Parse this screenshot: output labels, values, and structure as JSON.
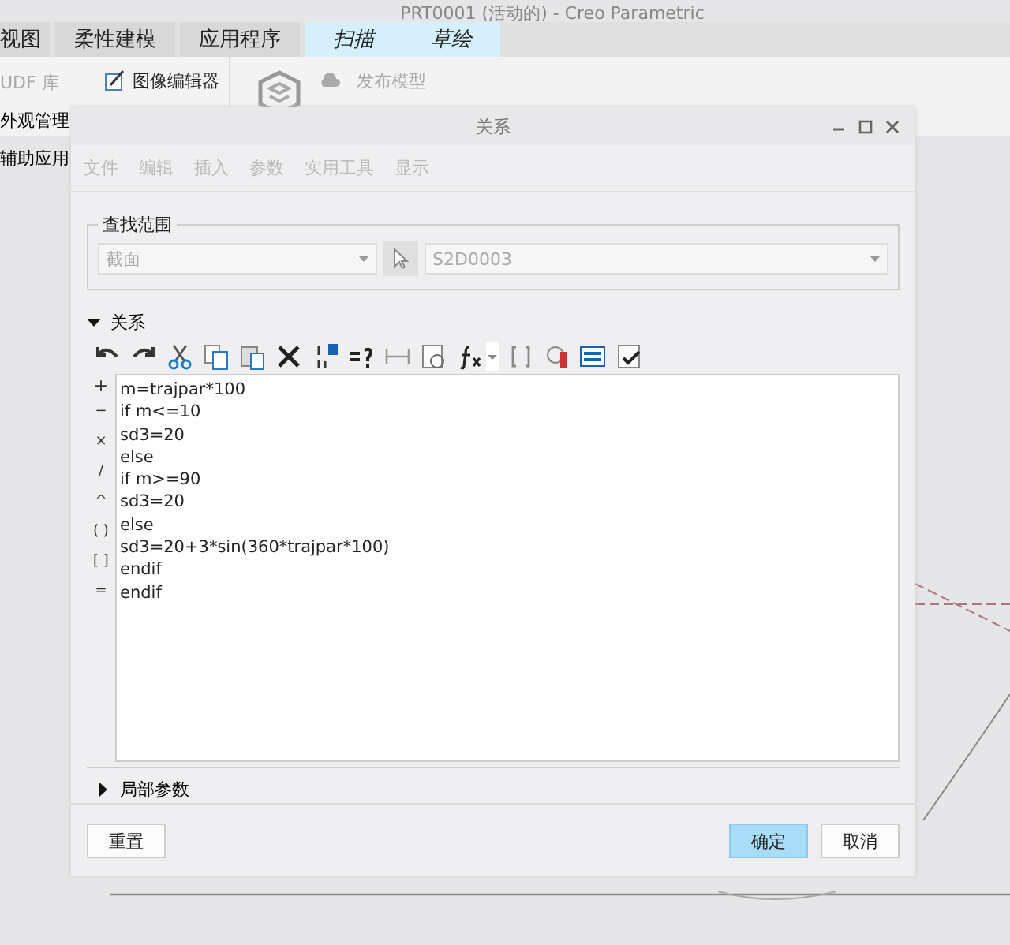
{
  "app_title": "PRT0001 (活动的) - Creo Parametric",
  "ribbon_tabs": [
    {
      "label": "视图",
      "kind": "normal"
    },
    {
      "label": "柔性建模",
      "kind": "normal"
    },
    {
      "label": "应用程序",
      "kind": "normal"
    },
    {
      "label": "扫描",
      "kind": "contextual"
    },
    {
      "label": "草绘",
      "kind": "contextual"
    }
  ],
  "ribbon_items": [
    {
      "label": "UDF 库",
      "disabled": true
    },
    {
      "label": "图像编辑器",
      "disabled": false
    },
    {
      "label": "发布模型",
      "disabled": true
    }
  ],
  "side_items": [
    "外观管理",
    "辅助应用"
  ],
  "dialog": {
    "title": "关系",
    "menu": [
      {
        "label": "文件",
        "disabled": true
      },
      {
        "label": "编辑",
        "disabled": true
      },
      {
        "label": "插入",
        "disabled": true
      },
      {
        "label": "参数",
        "disabled": true
      },
      {
        "label": "实用工具",
        "disabled": true
      },
      {
        "label": "显示",
        "disabled": true
      }
    ],
    "lookup": {
      "label": "查找范围",
      "type_value": "截面",
      "item_value": "S2D0003",
      "disabled": true
    },
    "relations": {
      "label": "关系",
      "expanded": true,
      "operators": [
        "+",
        "−",
        "×",
        "/",
        "^",
        "( )",
        "[ ]",
        "="
      ],
      "lines": [
        "m=trajpar*100",
        "if m<=10",
        "sd3=20",
        "else",
        "if m>=90",
        "sd3=20",
        "else",
        "sd3=20+3*sin(360*trajpar*100)",
        "endif",
        "endif"
      ]
    },
    "local_params": {
      "label": "局部参数",
      "expanded": false
    },
    "buttons": [
      {
        "label": "重置",
        "default": false
      },
      {
        "label": "确定",
        "default": true
      },
      {
        "label": "取消",
        "default": false
      }
    ]
  }
}
